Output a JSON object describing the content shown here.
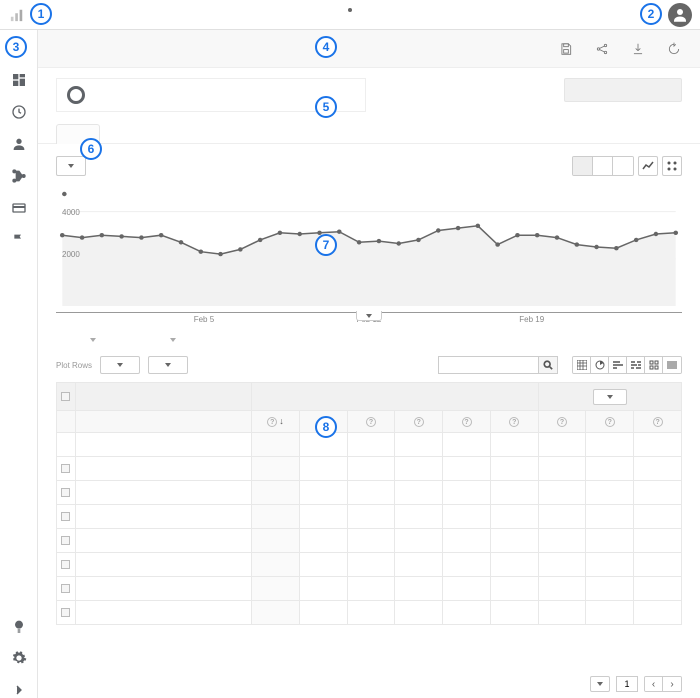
{
  "annotations": [
    "1",
    "2",
    "3",
    "4",
    "5",
    "6",
    "7",
    "8"
  ],
  "sidebar": {
    "items": [
      {
        "icon": "home"
      },
      {
        "icon": "dashboard"
      },
      {
        "icon": "clock"
      },
      {
        "icon": "person"
      },
      {
        "icon": "route"
      },
      {
        "icon": "card"
      },
      {
        "icon": "flag"
      }
    ],
    "bottom": [
      {
        "icon": "bulb"
      },
      {
        "icon": "gear"
      },
      {
        "icon": "chevron-right"
      }
    ]
  },
  "chart_data": {
    "type": "line",
    "title": "",
    "xlabel": "",
    "ylabel": "",
    "ylim": [
      0,
      5000
    ],
    "y_ticks": [
      2000,
      4000
    ],
    "x_ticks": [
      "Feb 5",
      "Feb 12",
      "Feb 19"
    ],
    "x": [
      0,
      1,
      2,
      3,
      4,
      5,
      6,
      7,
      8,
      9,
      10,
      11,
      12,
      13,
      14,
      15,
      16,
      17,
      18,
      19,
      20,
      21,
      22,
      23,
      24,
      25,
      26,
      27,
      28
    ],
    "values": [
      3000,
      2900,
      3000,
      2950,
      2900,
      3000,
      2700,
      2300,
      2200,
      2400,
      2800,
      3100,
      3050,
      3100,
      3150,
      2700,
      2750,
      2650,
      2800,
      3200,
      3300,
      3400,
      2600,
      3000,
      3000,
      2900,
      2600,
      2500,
      2450
    ],
    "extra_last": [
      2800,
      3050,
      3100
    ]
  },
  "toolbar": {
    "plot_rows_label": "Plot Rows"
  },
  "table": {
    "num_metric_cols": 9,
    "num_rows": 8
  },
  "pager": {
    "page": "1"
  }
}
